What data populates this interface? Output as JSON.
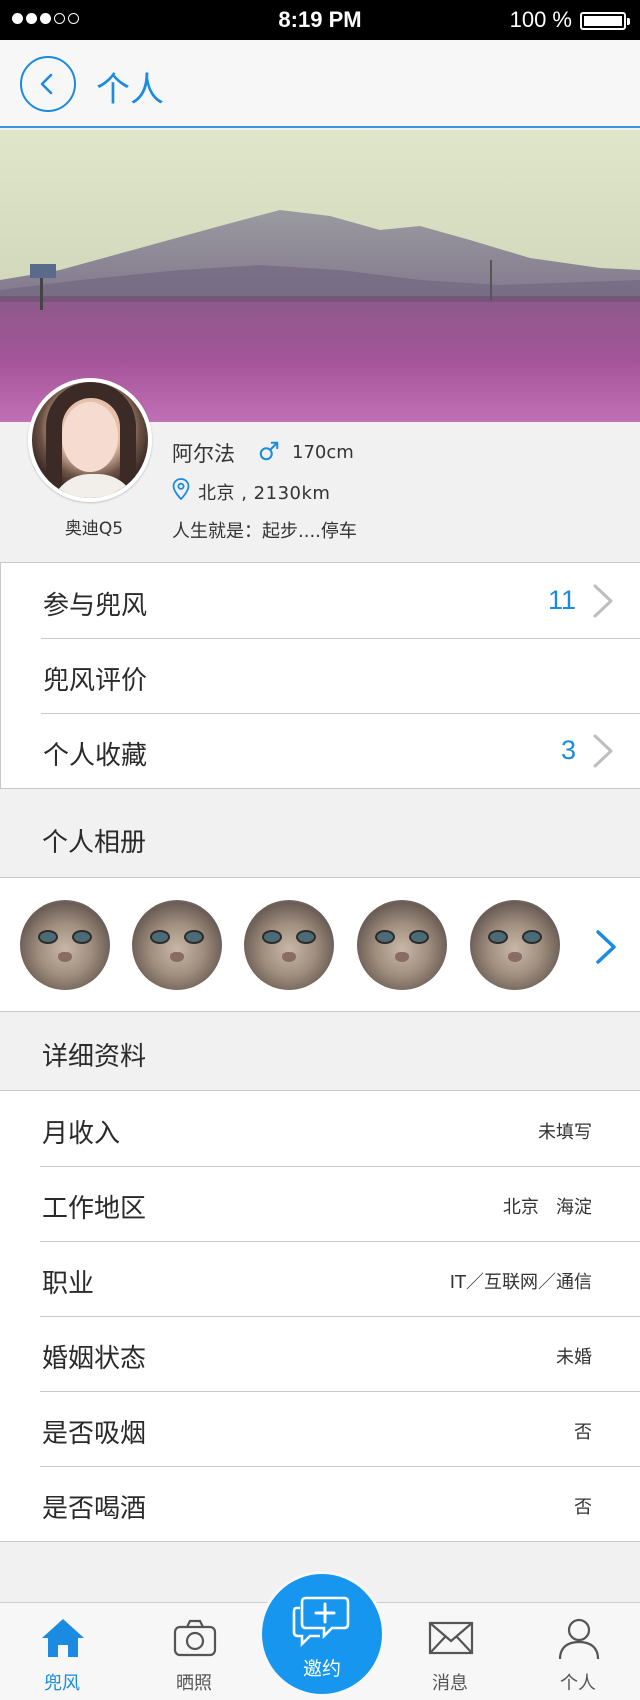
{
  "status_bar": {
    "time": "8:19 PM",
    "battery": "100 %"
  },
  "nav": {
    "title": "个人",
    "back_icon": "chevron-left-icon"
  },
  "profile": {
    "name": "阿尔法",
    "gender_icon": "male-icon",
    "height": "170cm",
    "location": "北京 , 2130km",
    "motto": "人生就是：起步....停车",
    "car": "奥迪Q5"
  },
  "stats": [
    {
      "label": "参与兜风",
      "count": "11"
    },
    {
      "label": "兜风评价",
      "count": ""
    },
    {
      "label": "个人收藏",
      "count": "3"
    }
  ],
  "album": {
    "title": "个人相册",
    "photo_count": 5
  },
  "details": {
    "title": "详细资料",
    "rows": [
      {
        "label": "月收入",
        "value": "未填写"
      },
      {
        "label": "工作地区",
        "value": "北京   海淀"
      },
      {
        "label": "职业",
        "value": "IT／互联网／通信"
      },
      {
        "label": "婚姻状态",
        "value": "未婚"
      },
      {
        "label": "是否吸烟",
        "value": "否"
      },
      {
        "label": "是否喝酒",
        "value": "否"
      }
    ]
  },
  "tabbar": {
    "tabs": [
      {
        "label": "兜风",
        "icon": "home-icon",
        "active": true
      },
      {
        "label": "晒照",
        "icon": "camera-icon"
      },
      {
        "label": "消息",
        "icon": "mail-icon"
      },
      {
        "label": "个人",
        "icon": "user-icon"
      }
    ],
    "center": {
      "label": "邀约",
      "icon": "chat-plus-icon"
    }
  },
  "colors": {
    "accent": "#1a8be0",
    "center_button": "#1796ef",
    "background": "#f1f1f2"
  }
}
